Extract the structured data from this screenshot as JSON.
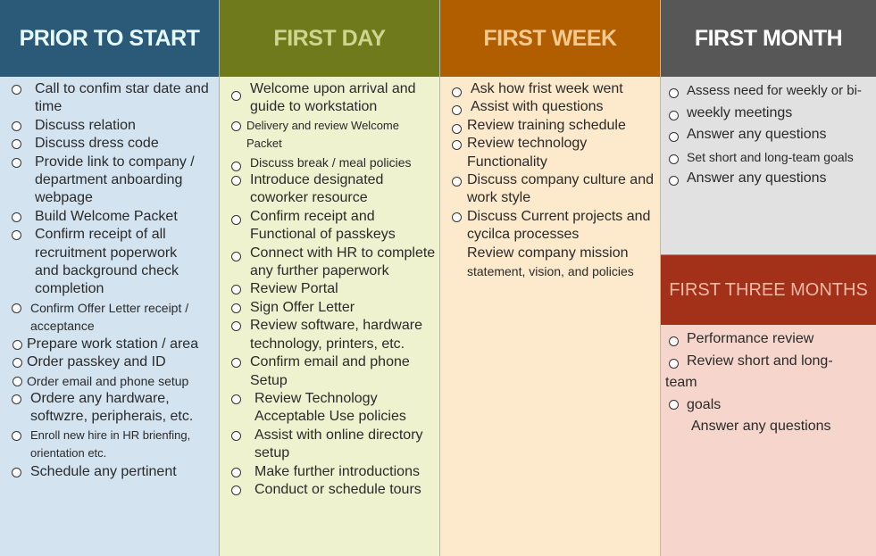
{
  "colors": {
    "prior": "#2b5a78",
    "first_day": "#6f7a1c",
    "first_week": "#b05e00",
    "first_month": "#575757",
    "three_months": "#a33018"
  },
  "columns": [
    {
      "title": "PRIOR TO START",
      "items": [
        "Call to confim star date and time",
        "Discuss relation",
        "Discuss dress code",
        "Provide link to company / department anboarding webpage",
        "Build Welcome Packet",
        "Confirm receipt of all recruitment poperwork and background check completion",
        "Confirm Offer Letter receipt / acceptance",
        "Prepare work station / area",
        "Order passkey and ID",
        "Order email and phone setup",
        "Ordere any hardware, softwzre, peripherais, etc.",
        "Enroll new hire in HR brienfing, orientation etc.",
        "Schedule any pertinent"
      ]
    },
    {
      "title": "FIRST DAY",
      "items": [
        "Welcome upon arrival and guide to workstation",
        "Delivery and review Welcome Packet",
        "Discuss break / meal policies",
        "Introduce designated coworker resource",
        "Confirm receipt and Functional of passkeys",
        "Connect with HR to complete any further paperwork",
        "Review Portal",
        "Sign Offer Letter",
        "Review software, hardware technology, printers, etc.",
        "Confirm email and phone Setup",
        "Review Technology Acceptable Use policies",
        "Assist with online directory setup",
        "Make further introductions",
        "Conduct or schedule tours"
      ]
    },
    {
      "title": "FIRST WEEK",
      "items": [
        "Ask how frist week went",
        "Assist with questions",
        "Review training schedule",
        "Review technology Functionality",
        "Discuss company culture and work style",
        "Discuss Current projects and cycilca processes",
        "Review company mission",
        "statement, vision, and policies"
      ]
    },
    {
      "title": "FIRST MONTH",
      "items": [
        "Assess need for weekly or bi-",
        "weekly meetings",
        "Answer any questions",
        "Set short and long-team goals",
        "Answer any questions"
      ]
    },
    {
      "title": "FIRST THREE MONTHS",
      "items": [
        "Performance review",
        "Review short and long-",
        "team",
        "goals",
        "Answer any questions"
      ]
    }
  ]
}
